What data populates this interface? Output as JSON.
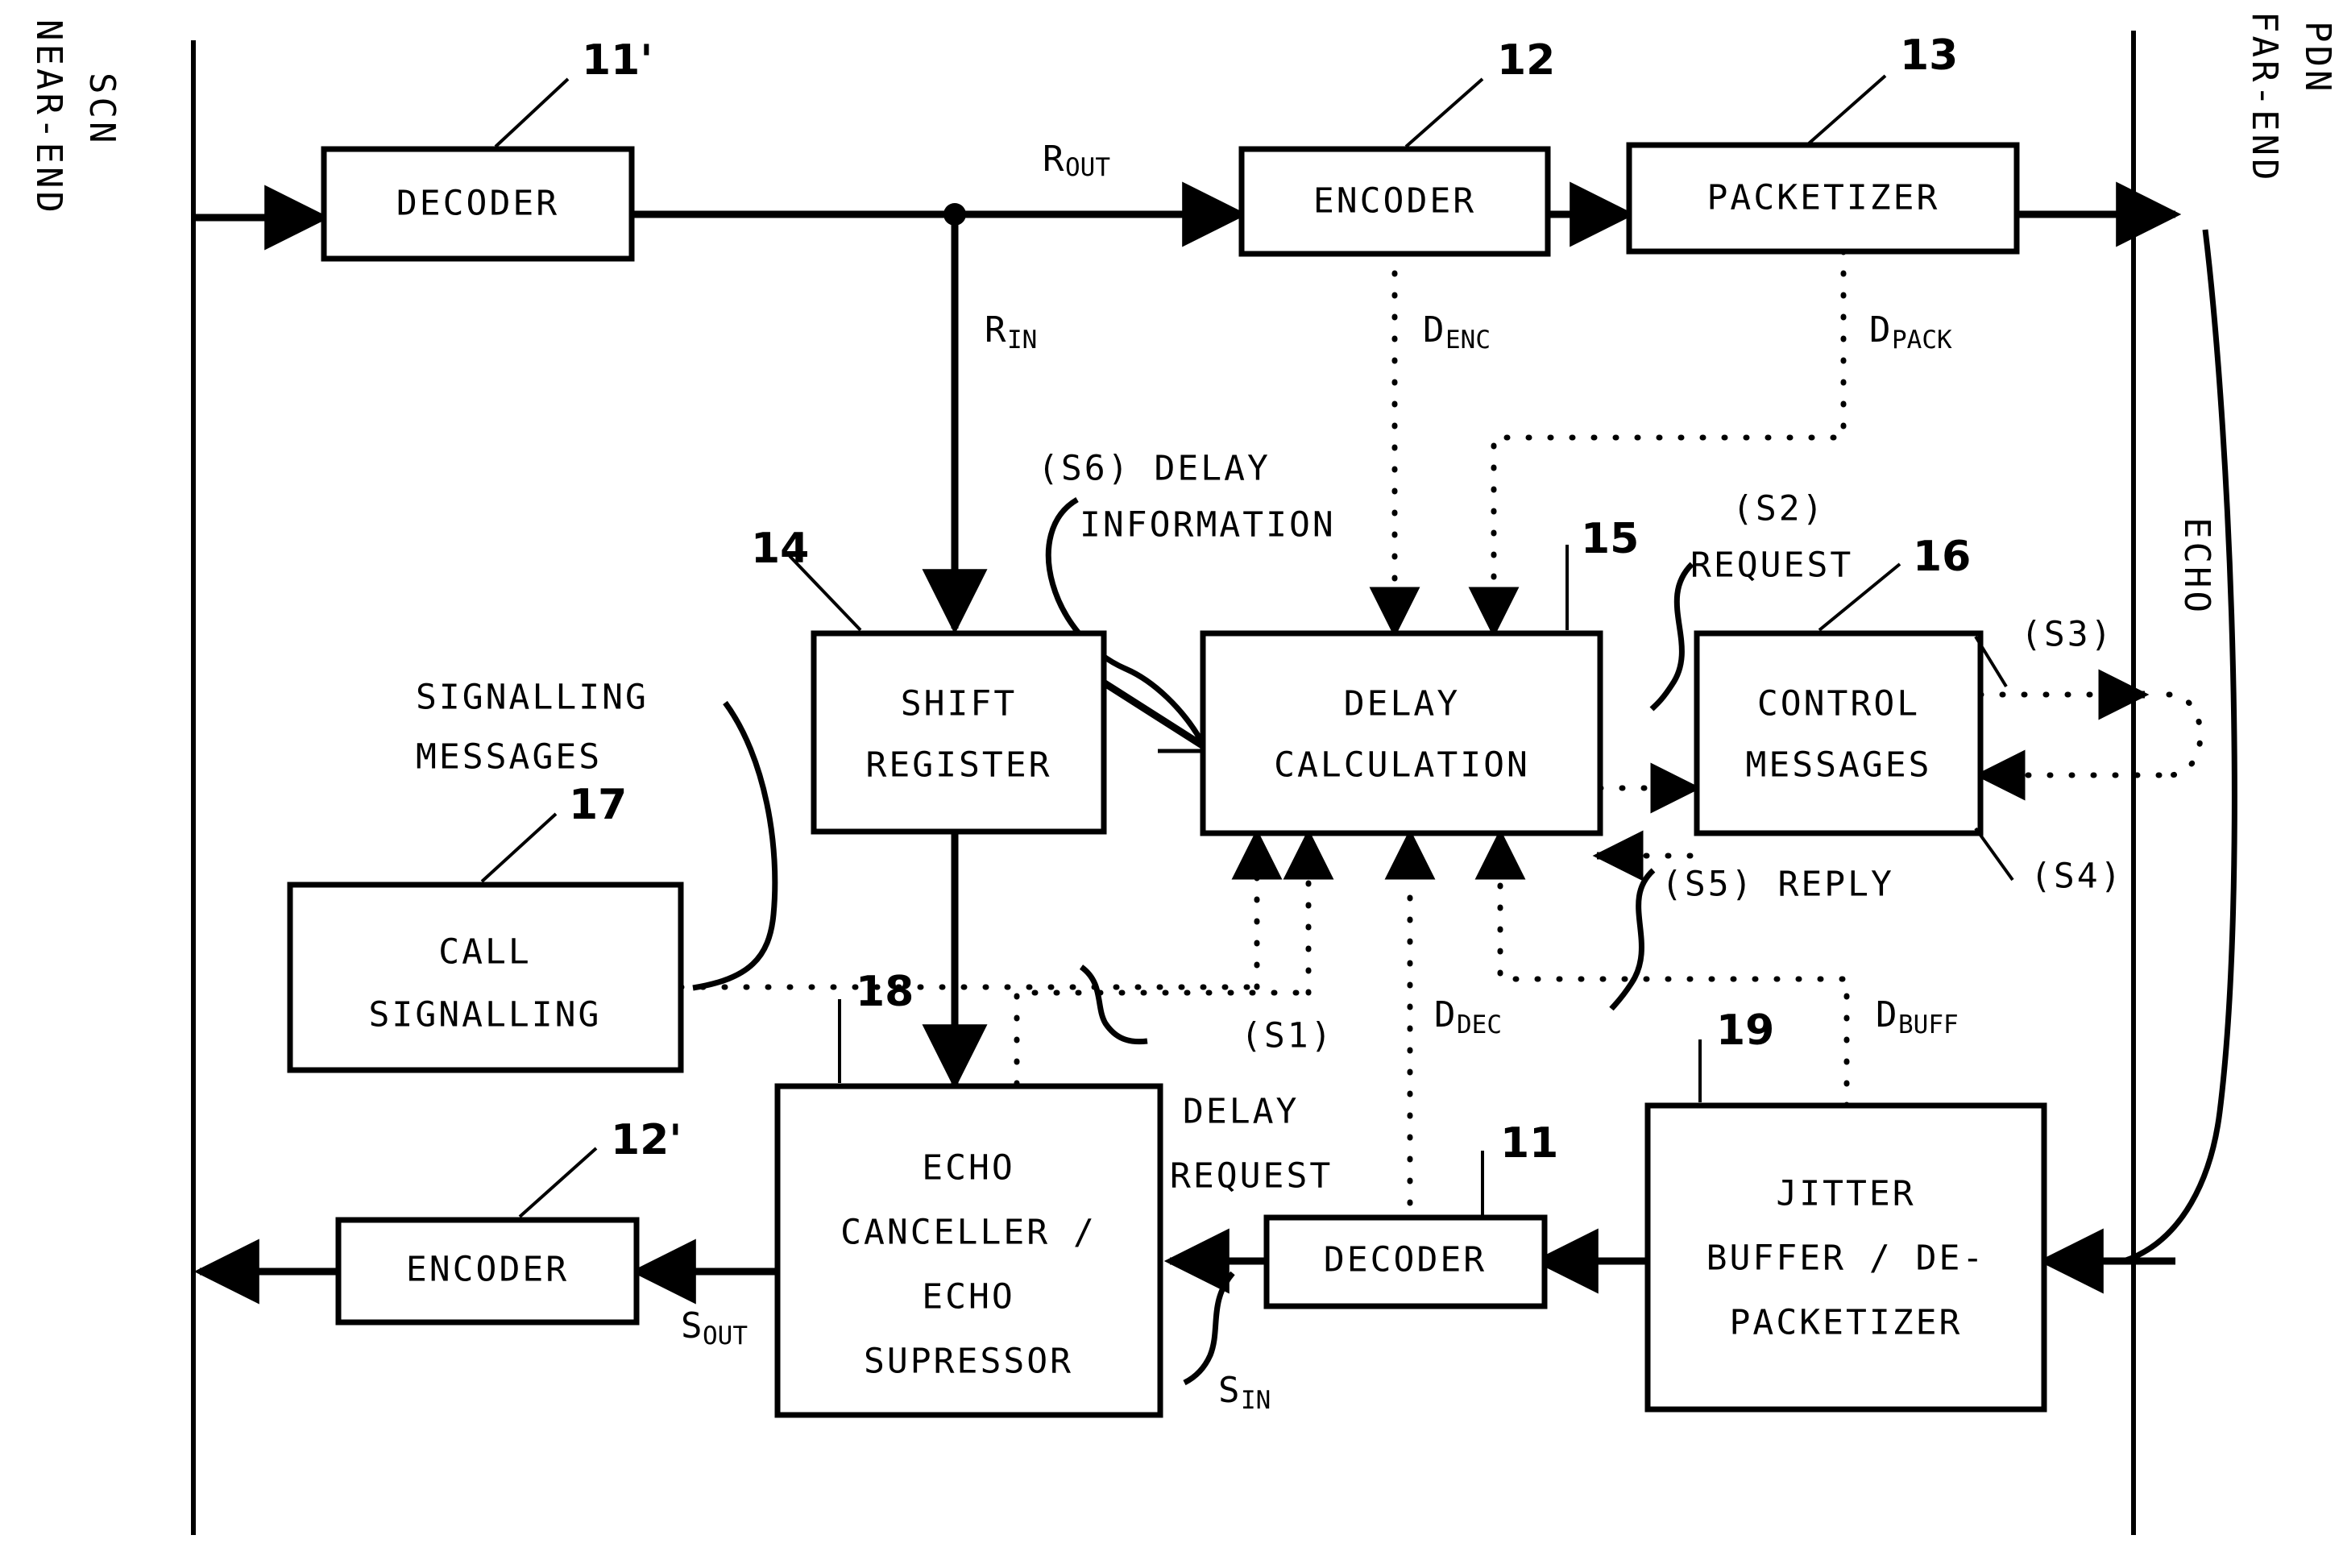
{
  "figure": {
    "type": "patent-block-diagram",
    "network_labels": {
      "left_top": "SCN",
      "left_bottom": "NEAR-END",
      "right_top": "PDN",
      "right_bottom": "FAR-END",
      "echo": "ECHO"
    },
    "blocks": [
      {
        "id": "decoder-top",
        "ref": "11'",
        "lines": [
          "DECODER"
        ]
      },
      {
        "id": "encoder-top",
        "ref": "12",
        "lines": [
          "ENCODER"
        ]
      },
      {
        "id": "packetizer",
        "ref": "13",
        "lines": [
          "PACKETIZER"
        ]
      },
      {
        "id": "shift-register",
        "ref": "14",
        "lines": [
          "SHIFT",
          "REGISTER"
        ]
      },
      {
        "id": "delay-calculation",
        "ref": "15",
        "lines": [
          "DELAY",
          "CALCULATION"
        ]
      },
      {
        "id": "control-messages",
        "ref": "16",
        "lines": [
          "CONTROL",
          "MESSAGES"
        ]
      },
      {
        "id": "call-signalling",
        "ref": "17",
        "lines": [
          "CALL",
          "SIGNALLING"
        ]
      },
      {
        "id": "echo-canceller",
        "ref": "18",
        "lines": [
          "ECHO",
          "CANCELLER /",
          "ECHO",
          "SUPRESSOR"
        ]
      },
      {
        "id": "encoder-bottom",
        "ref": "12'",
        "lines": [
          "ENCODER"
        ]
      },
      {
        "id": "decoder-bottom",
        "ref": "11",
        "lines": [
          "DECODER"
        ]
      },
      {
        "id": "jitter-buffer",
        "ref": "19",
        "lines": [
          "JITTER",
          "BUFFER / DE-",
          "PACKETIZER"
        ]
      }
    ],
    "signals": [
      {
        "id": "r-out",
        "base": "R",
        "sub": "OUT"
      },
      {
        "id": "r-in",
        "base": "R",
        "sub": "IN"
      },
      {
        "id": "s-out",
        "base": "S",
        "sub": "OUT"
      },
      {
        "id": "s-in",
        "base": "S",
        "sub": "IN"
      },
      {
        "id": "d-enc",
        "base": "D",
        "sub": "ENC"
      },
      {
        "id": "d-pack",
        "base": "D",
        "sub": "PACK"
      },
      {
        "id": "d-dec",
        "base": "D",
        "sub": "DEC"
      },
      {
        "id": "d-buff",
        "base": "D",
        "sub": "BUFF"
      }
    ],
    "annotations": [
      {
        "id": "s6",
        "tag": "(S6)",
        "line1": "(S6) DELAY",
        "line2": "INFORMATION"
      },
      {
        "id": "s2",
        "tag": "(S2)",
        "line1": "(S2)",
        "line2": "REQUEST"
      },
      {
        "id": "s3",
        "tag": "(S3)",
        "line1": "(S3)",
        "line2": ""
      },
      {
        "id": "s4",
        "tag": "(S4)",
        "line1": "(S4)",
        "line2": ""
      },
      {
        "id": "s5",
        "tag": "(S5)",
        "line1": "(S5) REPLY",
        "line2": ""
      },
      {
        "id": "s1",
        "tag": "(S1)",
        "line1": "(S1)",
        "line2": "DELAY",
        "line3": "REQUEST"
      },
      {
        "id": "signalling-messages",
        "tag": "",
        "line1": "SIGNALLING",
        "line2": "MESSAGES"
      }
    ],
    "colors": {
      "ink": "#000000",
      "paper": "#ffffff"
    }
  }
}
